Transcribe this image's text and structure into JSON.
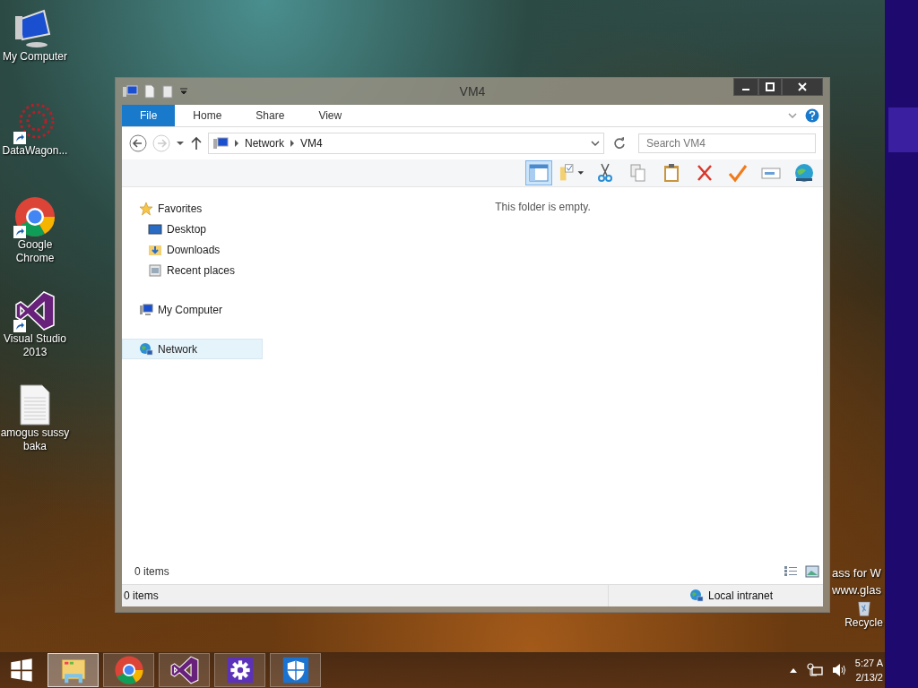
{
  "desktop": {
    "icons": [
      {
        "kind": "computer",
        "label": "My Computer",
        "shortcut": false
      },
      {
        "kind": "burst",
        "label": "DataWagon...",
        "shortcut": true
      },
      {
        "kind": "chrome",
        "label": "Google Chrome",
        "shortcut": true
      },
      {
        "kind": "studio",
        "label": "Visual Studio 2013",
        "shortcut": true
      },
      {
        "kind": "document",
        "label": "amogus sussy baka",
        "shortcut": false
      }
    ],
    "overlay_text": [
      "ass for W",
      "www.glas"
    ],
    "recycle_bin": {
      "label": "Recycle"
    }
  },
  "window": {
    "title": "VM4",
    "ribbon_tabs": [
      {
        "label": "File",
        "kind": "file"
      },
      {
        "label": "Home",
        "kind": "tab"
      },
      {
        "label": "Share",
        "kind": "tab"
      },
      {
        "label": "View",
        "kind": "tab"
      }
    ],
    "address": {
      "crumbs": [
        "Network",
        "VM4"
      ]
    },
    "search": {
      "placeholder": "Search VM4"
    },
    "nav_pane": [
      {
        "label": "Favorites",
        "kind": "star",
        "selected": false,
        "children": [
          {
            "label": "Desktop",
            "kind": "desktop",
            "selected": false
          },
          {
            "label": "Downloads",
            "kind": "downloads",
            "selected": false
          },
          {
            "label": "Recent places",
            "kind": "recent",
            "selected": false
          }
        ]
      },
      {
        "label": "My Computer",
        "kind": "computer",
        "selected": false
      },
      {
        "label": "Network",
        "kind": "network",
        "selected": true
      }
    ],
    "empty_message": "This folder is empty.",
    "item_count": "0 items",
    "status_bar": {
      "items": "0 items",
      "zone": "Local intranet"
    }
  },
  "taskbar": {
    "apps": [
      {
        "kind": "start",
        "selected": false
      },
      {
        "kind": "explorer",
        "selected": true
      },
      {
        "kind": "chrome",
        "selected": false
      },
      {
        "kind": "studio",
        "selected": false
      },
      {
        "kind": "settings",
        "selected": false
      },
      {
        "kind": "defender",
        "selected": false
      }
    ],
    "clock": {
      "time": "5:27 A",
      "date": "2/13/2"
    }
  }
}
